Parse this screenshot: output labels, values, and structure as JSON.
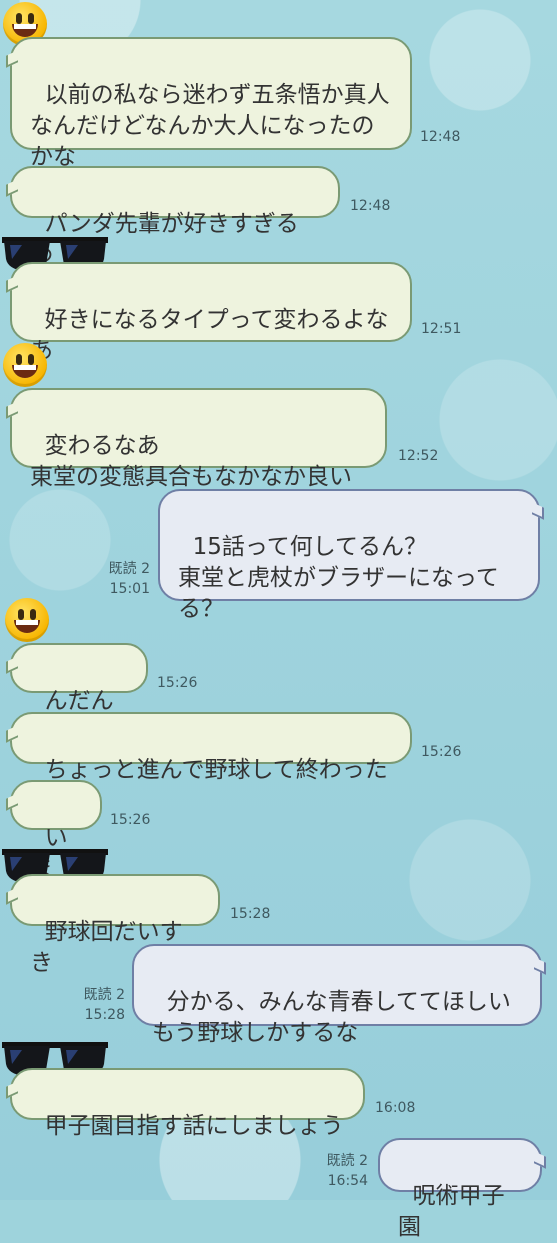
{
  "messages": [
    {
      "id": "m1",
      "text": "以前の私なら迷わず五条悟か真人\nなんだけどなんか大人になったの\nかな",
      "time": "12:48"
    },
    {
      "id": "m2",
      "text": "パンダ先輩が好きすぎるわ",
      "time": "12:48"
    },
    {
      "id": "m3",
      "text": "好きになるタイプって変わるよな\nあ",
      "time": "12:51"
    },
    {
      "id": "m4",
      "text": "変わるなあ\n東堂の変態具合もなかなか良い",
      "time": "12:52"
    },
    {
      "id": "m5",
      "text": "15話って何してるん？\n東堂と虎杖がブラザーになって\nる？",
      "time": "15:01",
      "read": "既読 2"
    },
    {
      "id": "m6",
      "text": "んだんだ",
      "time": "15:26"
    },
    {
      "id": "m7",
      "text": "ちょっと進んで野球して終わった",
      "time": "15:26"
    },
    {
      "id": "m8",
      "text": "いま",
      "time": "15:26"
    },
    {
      "id": "m9",
      "text": "野球回だいすき",
      "time": "15:28"
    },
    {
      "id": "m10",
      "text": "分かる、みんな青春しててほしい\nもう野球しかするな",
      "time": "15:28",
      "read": "既読 2"
    },
    {
      "id": "m11",
      "text": "甲子園目指す話にしましょう",
      "time": "16:08"
    },
    {
      "id": "m12",
      "text": "呪術甲子園",
      "time": "16:54",
      "read": "既読 2"
    }
  ],
  "avatars": {
    "smile": "grinning-face-emoji",
    "glasses": "sunglasses-emoji"
  }
}
